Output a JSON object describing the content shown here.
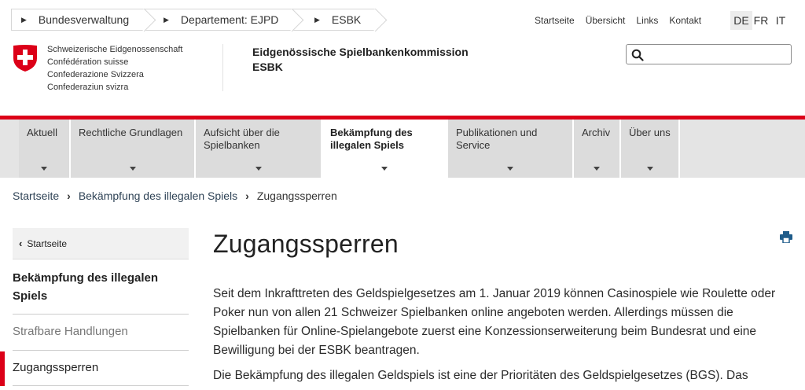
{
  "breadcrumb_top": [
    {
      "label": "Bundesverwaltung"
    },
    {
      "label": "Departement: EJPD"
    },
    {
      "label": "ESBK"
    }
  ],
  "service_nav": [
    "Startseite",
    "Übersicht",
    "Links",
    "Kontakt"
  ],
  "languages": [
    {
      "code": "DE",
      "active": true
    },
    {
      "code": "FR",
      "active": false
    },
    {
      "code": "IT",
      "active": false
    }
  ],
  "confederation": [
    "Schweizerische Eidgenossenschaft",
    "Confédération suisse",
    "Confederazione Svizzera",
    "Confederaziun svizra"
  ],
  "org": {
    "line1": "Eidgenössische Spielbankenkommission",
    "line2": "ESBK"
  },
  "search": {
    "placeholder": "",
    "value": ""
  },
  "colors": {
    "accent_red": "#dc0018",
    "link": "#2f4356"
  },
  "main_nav": [
    {
      "label": "Aktuell",
      "active": false
    },
    {
      "label": "Rechtliche Grundlagen",
      "active": false
    },
    {
      "label": "Aufsicht über die Spielbanken",
      "active": false
    },
    {
      "label": "Bekämpfung des illegalen Spiels",
      "active": true
    },
    {
      "label": "Publikationen und Service",
      "active": false
    },
    {
      "label": "Archiv",
      "active": false
    },
    {
      "label": "Über uns",
      "active": false
    }
  ],
  "breadcrumb": {
    "items": [
      "Startseite",
      "Bekämpfung des illegalen Spiels"
    ],
    "current": "Zugangssperren"
  },
  "sidebar": {
    "back_label": "Startseite",
    "heading": "Bekämpfung des illegalen Spiels",
    "items": [
      {
        "label": "Strafbare Handlungen",
        "active": false
      },
      {
        "label": "Zugangssperren",
        "active": true
      }
    ]
  },
  "content": {
    "title": "Zugangssperren",
    "paragraph1": "Seit dem Inkrafttreten des Geldspielgesetzes am 1. Januar 2019 können Casinospiele wie Roulette oder Poker nun von allen 21 Schweizer Spielbanken online angeboten werden. Allerdings müssen die Spielbanken für Online-Spielangebote zuerst eine Konzessionserweiterung beim Bundesrat und eine Bewilligung bei der ESBK beantragen.",
    "paragraph2": "Die Bekämpfung des illegalen Geldspiels ist eine der Prioritäten des Geldspielgesetzes (BGS). Das"
  }
}
